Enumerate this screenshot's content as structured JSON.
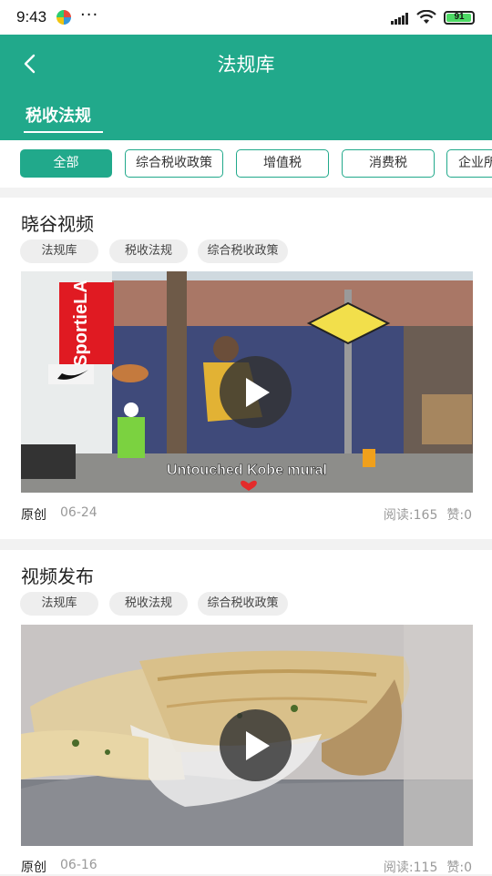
{
  "status": {
    "time": "9:43",
    "more": "···",
    "battery": "91"
  },
  "header": {
    "title": "法规库",
    "tab": "税收法规"
  },
  "filters": [
    "全部",
    "综合税收政策",
    "增值税",
    "消费税",
    "企业所"
  ],
  "articles": [
    {
      "title": "晓谷视频",
      "tags": [
        "法规库",
        "税收法规",
        "综合税收政策"
      ],
      "video_caption": "Untouched Kobe mural",
      "store_sign": "SportieLA",
      "source": "原创",
      "date": "06-24",
      "reads": "阅读:165",
      "likes": "赞:0"
    },
    {
      "title": "视频发布",
      "tags": [
        "法规库",
        "税收法规",
        "综合税收政策"
      ],
      "source": "原创",
      "date": "06-16",
      "reads": "阅读:115",
      "likes": "赞:0"
    }
  ],
  "colors": {
    "accent": "#21a98b"
  }
}
